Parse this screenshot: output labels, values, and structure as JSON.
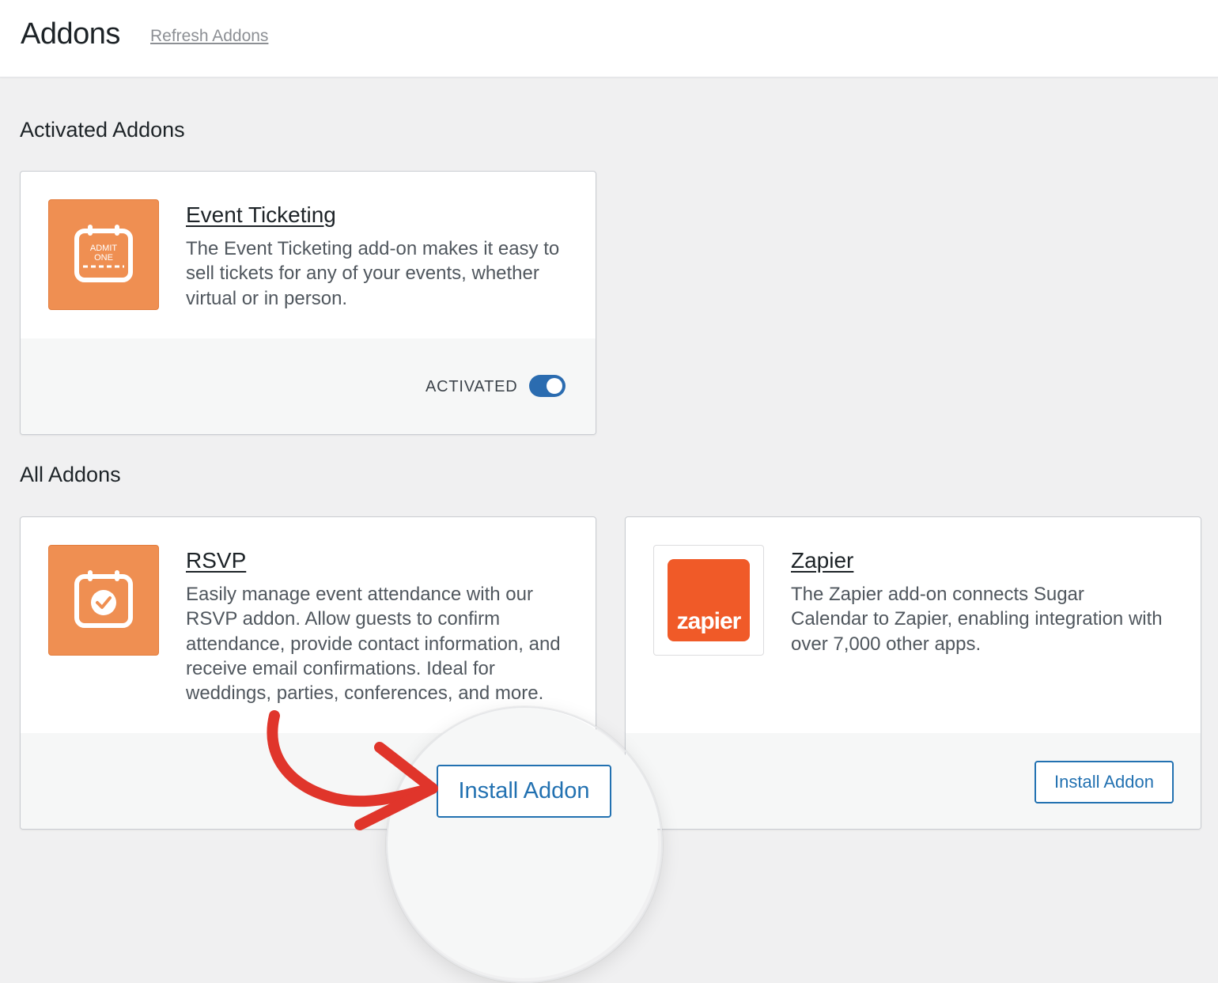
{
  "header": {
    "title": "Addons",
    "refresh_label": "Refresh Addons"
  },
  "sections": {
    "activated": "Activated Addons",
    "all": "All Addons"
  },
  "activated_addon": {
    "title": "Event Ticketing",
    "description": "The Event Ticketing add-on makes it easy to sell tickets for any of your events, whether virtual or in person.",
    "status_label": "ACTIVATED",
    "toggle_on": true,
    "icon": "ticket-calendar-icon",
    "icon_text_1": "ADMIT",
    "icon_text_2": "ONE"
  },
  "addons": [
    {
      "title": "RSVP",
      "description": "Easily manage event attendance with our RSVP addon. Allow guests to confirm attendance, provide contact information, and receive email confirmations. Ideal for weddings, parties, conferences, and more.",
      "button_label": "Install Addon",
      "icon": "calendar-check-icon"
    },
    {
      "title": "Zapier",
      "description": "The Zapier add-on connects Sugar Calendar to Zapier, enabling integration with over 7,000 other apps.",
      "button_label": "Install Addon",
      "icon": "zapier-logo",
      "logo_text": "zapier"
    }
  ],
  "colors": {
    "accent": "#2271b1",
    "icon_orange": "#ef8f52",
    "zapier_orange": "#ff4f00",
    "annotation_red": "#e0352b",
    "toggle": "#2b6cb0"
  }
}
